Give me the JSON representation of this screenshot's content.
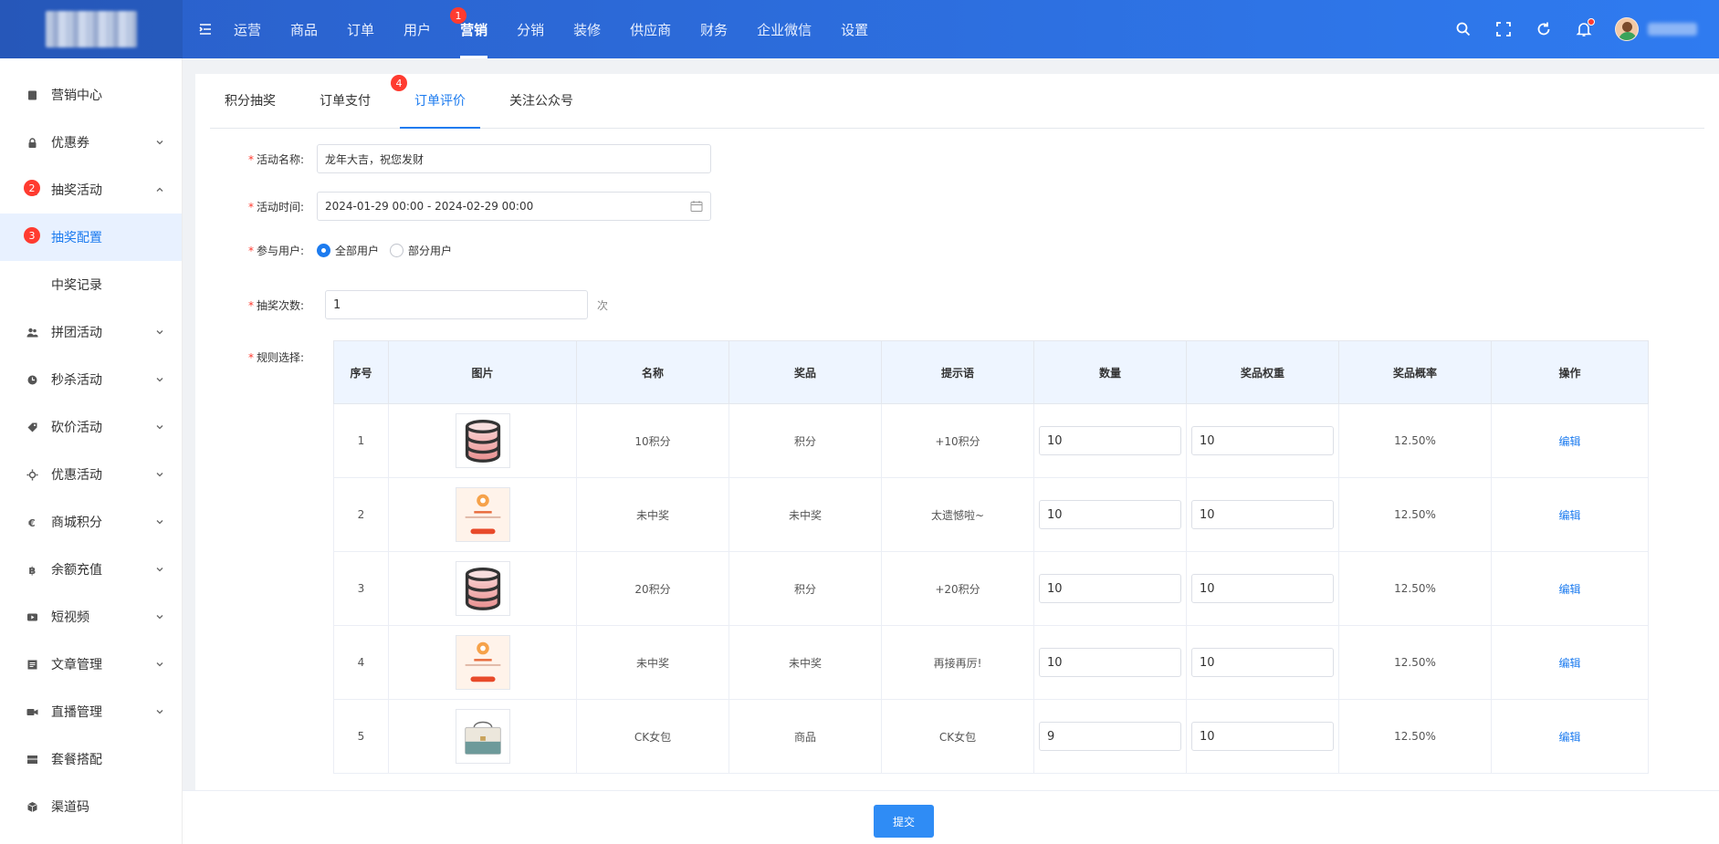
{
  "nav": {
    "items": [
      {
        "label": "运营"
      },
      {
        "label": "商品"
      },
      {
        "label": "订单"
      },
      {
        "label": "用户"
      },
      {
        "label": "营销",
        "active": true,
        "badge": "1"
      },
      {
        "label": "分销"
      },
      {
        "label": "装修"
      },
      {
        "label": "供应商"
      },
      {
        "label": "财务"
      },
      {
        "label": "企业微信"
      },
      {
        "label": "设置"
      }
    ]
  },
  "sidebar": {
    "items": [
      {
        "label": "营销中心",
        "icon": "folder-icon"
      },
      {
        "label": "优惠券",
        "icon": "lock-icon",
        "chevron": "down"
      },
      {
        "label": "抽奖活动",
        "icon": "gift-icon",
        "chevron": "up",
        "badge": "2"
      },
      {
        "label": "抽奖配置",
        "sub": true,
        "active": true,
        "badge": "3"
      },
      {
        "label": "中奖记录",
        "sub": true
      },
      {
        "label": "拼团活动",
        "icon": "group-icon",
        "chevron": "down"
      },
      {
        "label": "秒杀活动",
        "icon": "clock-icon",
        "chevron": "down"
      },
      {
        "label": "砍价活动",
        "icon": "tag-icon",
        "chevron": "down"
      },
      {
        "label": "优惠活动",
        "icon": "discount-icon",
        "chevron": "down"
      },
      {
        "label": "商城积分",
        "icon": "euro-icon",
        "chevron": "down"
      },
      {
        "label": "余额充值",
        "icon": "bitcoin-icon",
        "chevron": "down"
      },
      {
        "label": "短视频",
        "icon": "video-icon",
        "chevron": "down"
      },
      {
        "label": "文章管理",
        "icon": "article-icon",
        "chevron": "down"
      },
      {
        "label": "直播管理",
        "icon": "camera-icon",
        "chevron": "down"
      },
      {
        "label": "套餐搭配",
        "icon": "package-icon"
      },
      {
        "label": "渠道码",
        "icon": "cube-icon"
      }
    ]
  },
  "tabs": [
    {
      "label": "积分抽奖"
    },
    {
      "label": "订单支付"
    },
    {
      "label": "订单评价",
      "active": true,
      "badge": "4"
    },
    {
      "label": "关注公众号"
    }
  ],
  "form": {
    "name_label": "活动名称:",
    "name_value": "龙年大吉，祝您发财",
    "time_label": "活动时间:",
    "time_value": "2024-01-29 00:00 - 2024-02-29 00:00",
    "users_label": "参与用户:",
    "users_options": [
      {
        "label": "全部用户",
        "checked": true
      },
      {
        "label": "部分用户",
        "checked": false
      }
    ],
    "count_label": "抽奖次数:",
    "count_value": "1",
    "count_unit": "次",
    "rules_label": "规则选择:"
  },
  "table": {
    "headers": [
      "序号",
      "图片",
      "名称",
      "奖品",
      "提示语",
      "数量",
      "奖品权重",
      "奖品概率",
      "操作"
    ],
    "rows": [
      {
        "index": "1",
        "image": "coins-image",
        "name": "10积分",
        "prize": "积分",
        "tip": "+10积分",
        "qty": "10",
        "weight": "10",
        "prob": "12.50%",
        "action": "编辑"
      },
      {
        "index": "2",
        "image": "no-prize-card-image",
        "name": "未中奖",
        "prize": "未中奖",
        "tip": "太遗憾啦~",
        "qty": "10",
        "weight": "10",
        "prob": "12.50%",
        "action": "编辑"
      },
      {
        "index": "3",
        "image": "coins-image",
        "name": "20积分",
        "prize": "积分",
        "tip": "+20积分",
        "qty": "10",
        "weight": "10",
        "prob": "12.50%",
        "action": "编辑"
      },
      {
        "index": "4",
        "image": "no-prize-card-image",
        "name": "未中奖",
        "prize": "未中奖",
        "tip": "再接再厉!",
        "qty": "10",
        "weight": "10",
        "prob": "12.50%",
        "action": "编辑"
      },
      {
        "index": "5",
        "image": "handbag-image",
        "name": "CK女包",
        "prize": "商品",
        "tip": "CK女包",
        "qty": "9",
        "weight": "10",
        "prob": "12.50%",
        "action": "编辑"
      }
    ]
  },
  "footer": {
    "submit_label": "提交"
  },
  "colors": {
    "primary": "#1c7bef",
    "topbar": "#2f7bf0",
    "badge": "#ff3b30"
  }
}
